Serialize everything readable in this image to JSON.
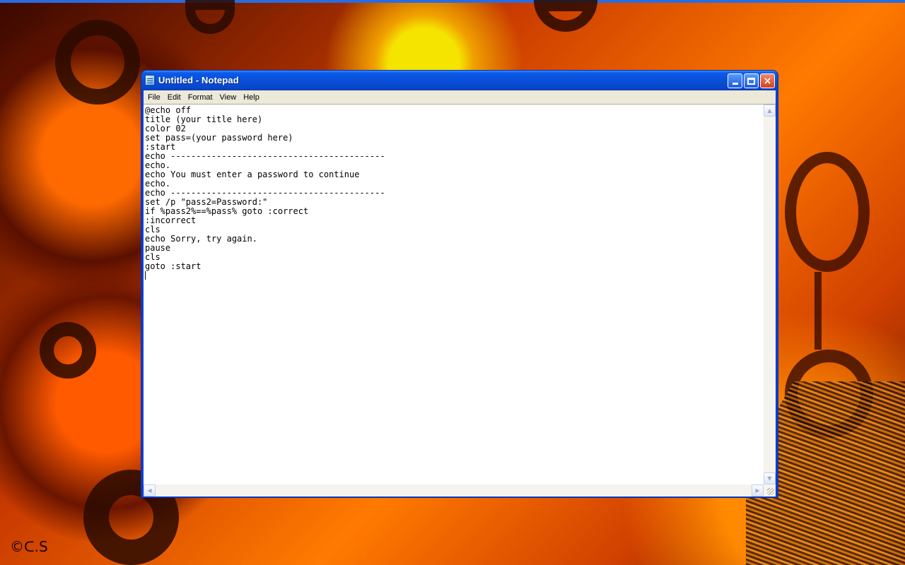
{
  "window": {
    "title": "Untitled - Notepad",
    "icon": "notepad-icon",
    "controls": {
      "minimize": "minimize-icon",
      "maximize": "maximize-icon",
      "close": "×"
    }
  },
  "menu": {
    "items": [
      "File",
      "Edit",
      "Format",
      "View",
      "Help"
    ]
  },
  "editor": {
    "content": "@echo off\ntitle (your title here)\ncolor 02\nset pass=(your password here)\n:start\necho ------------------------------------------\necho.\necho You must enter a password to continue\necho.\necho ------------------------------------------\nset /p \"pass2=Password:\"\nif %pass2%==%pass% goto :correct\n:incorrect\ncls\necho Sorry, try again.\npause\ncls\ngoto :start"
  },
  "scrollbars": {
    "up": "▲",
    "down": "▼",
    "left": "◀",
    "right": "▶"
  },
  "desktop": {
    "watermark": "©ᑕ.S"
  },
  "colors": {
    "titlebar": "#0a4fd8",
    "menubar": "#ece9d8",
    "close_button": "#d8401a"
  }
}
